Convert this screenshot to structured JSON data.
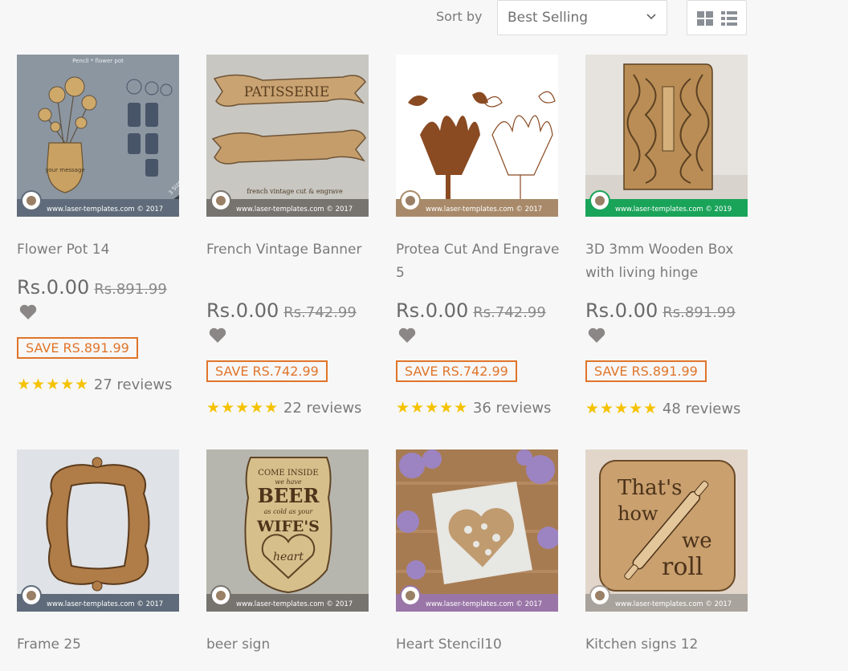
{
  "toolbar": {
    "sort_label": "Sort by",
    "sort_value": "Best Selling",
    "view_modes": [
      "grid",
      "list"
    ]
  },
  "products": [
    {
      "title": "Flower Pot 14",
      "price": "Rs.0.00",
      "original_price": "Rs.891.99",
      "save": "SAVE RS.891.99",
      "stars": "★★★★★",
      "reviews": "27 reviews",
      "image_caption": "Pencil * flower pot",
      "image_text": "your message",
      "image_badge": "3 Sizes",
      "watermark": "www.laser-templates.com © 2017"
    },
    {
      "title": "French Vintage Banner",
      "price": "Rs.0.00",
      "original_price": "Rs.742.99",
      "save": "SAVE RS.742.99",
      "stars": "★★★★★",
      "reviews": "22 reviews",
      "image_text": "PATISSERIE",
      "image_caption": "french vintage cut & engrave",
      "watermark": "www.laser-templates.com © 2017"
    },
    {
      "title": "Protea Cut And Engrave 5",
      "price": "Rs.0.00",
      "original_price": "Rs.742.99",
      "save": "SAVE RS.742.99",
      "stars": "★★★★★",
      "reviews": "36 reviews",
      "watermark": "www.laser-templates.com © 2017"
    },
    {
      "title": "3D 3mm Wooden Box with living hinge",
      "price": "Rs.0.00",
      "original_price": "Rs.891.99",
      "save": "SAVE RS.891.99",
      "stars": "★★★★★",
      "reviews": "48 reviews",
      "watermark": "www.laser-templates.com © 2019"
    },
    {
      "title": "Frame 25",
      "watermark": "www.laser-templates.com © 2017"
    },
    {
      "title": "beer sign",
      "image_lines": [
        "COME INSIDE",
        "we have",
        "BEER",
        "as cold as your",
        "WIFE'S",
        "heart"
      ],
      "watermark": "www.laser-templates.com © 2017"
    },
    {
      "title": "Heart Stencil10",
      "watermark": "www.laser-templates.com © 2017"
    },
    {
      "title": "Kitchen signs 12",
      "image_lines": [
        "That's",
        "how",
        "we",
        "roll"
      ],
      "watermark": "www.laser-templates.com © 2017"
    }
  ],
  "colors": {
    "accent": "#e0752a",
    "star": "#f5c200",
    "heart": "#8c8787",
    "band_default": "#5f6b7a",
    "band_brown": "#a88a6a",
    "band_green": "#1aa45a",
    "band_purple": "#9a75a7"
  }
}
